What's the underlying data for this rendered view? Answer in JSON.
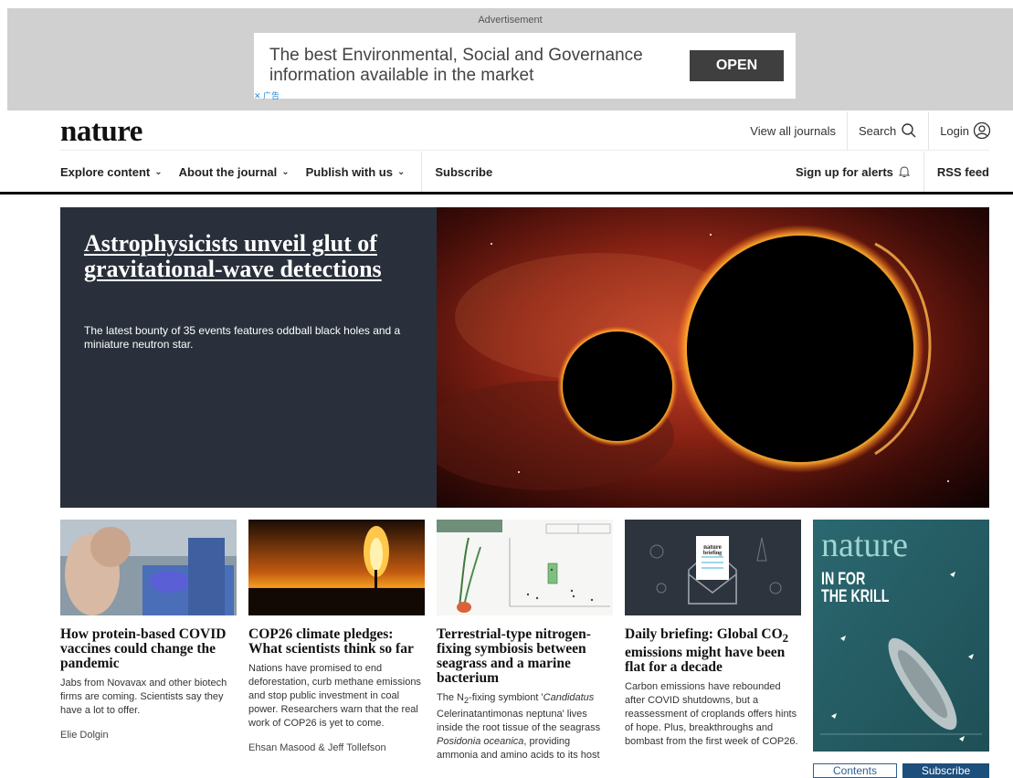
{
  "ad": {
    "label": "Advertisement",
    "text": "The best Environmental, Social and Governance information available in the market",
    "button": "OPEN",
    "choices": "✕ 广告"
  },
  "header": {
    "logo": "nature",
    "view_all": "View all journals",
    "search": "Search",
    "login": "Login"
  },
  "nav": {
    "explore": "Explore content",
    "about": "About the journal",
    "publish": "Publish with us",
    "subscribe": "Subscribe",
    "alerts": "Sign up for alerts",
    "rss": "RSS feed"
  },
  "hero": {
    "title": "Astrophysicists unveil glut of gravitational-wave detections",
    "subtitle": "The latest bounty of 35 events features oddball black holes and a miniature neutron star."
  },
  "cards": [
    {
      "title": "How protein-based COVID vaccines could change the pandemic",
      "summary": "Jabs from Novavax and other biotech firms are coming. Scientists say they have a lot to offer.",
      "author": "Elie Dolgin"
    },
    {
      "title": "COP26 climate pledges: What scientists think so far",
      "summary": "Nations have promised to end deforestation, curb methane emissions and stop public investment in coal power. Researchers warn that the real work of COP26 is yet to come.",
      "author": "Ehsan Masood & Jeff Tollefson"
    },
    {
      "title": "Terrestrial-type nitrogen-fixing symbiosis between seagrass and a marine bacterium",
      "summary_a": "The N",
      "summary_sub": "2",
      "summary_b": "-fixing symbiont '",
      "summary_i1": "Candidatus",
      "summary_c": " Celerinatantimonas neptuna' lives inside the root tissue of the seagrass ",
      "summary_i2": "Posidonia oceanica",
      "summary_d": ", providing ammonia and amino acids to its host"
    },
    {
      "title_a": "Daily briefing: Global CO",
      "title_sub": "2",
      "title_b": " emissions might have been flat for a decade",
      "summary": "Carbon emissions have rebounded after COVID shutdowns, but a reassessment of croplands offers hints of hope. Plus, breakthroughs and bombast from the first week of COP26."
    }
  ],
  "cover": {
    "masthead": "nature",
    "headline_1": "IN FOR",
    "headline_2": "THE KRILL",
    "contents": "Contents",
    "subscribe": "Subscribe"
  }
}
